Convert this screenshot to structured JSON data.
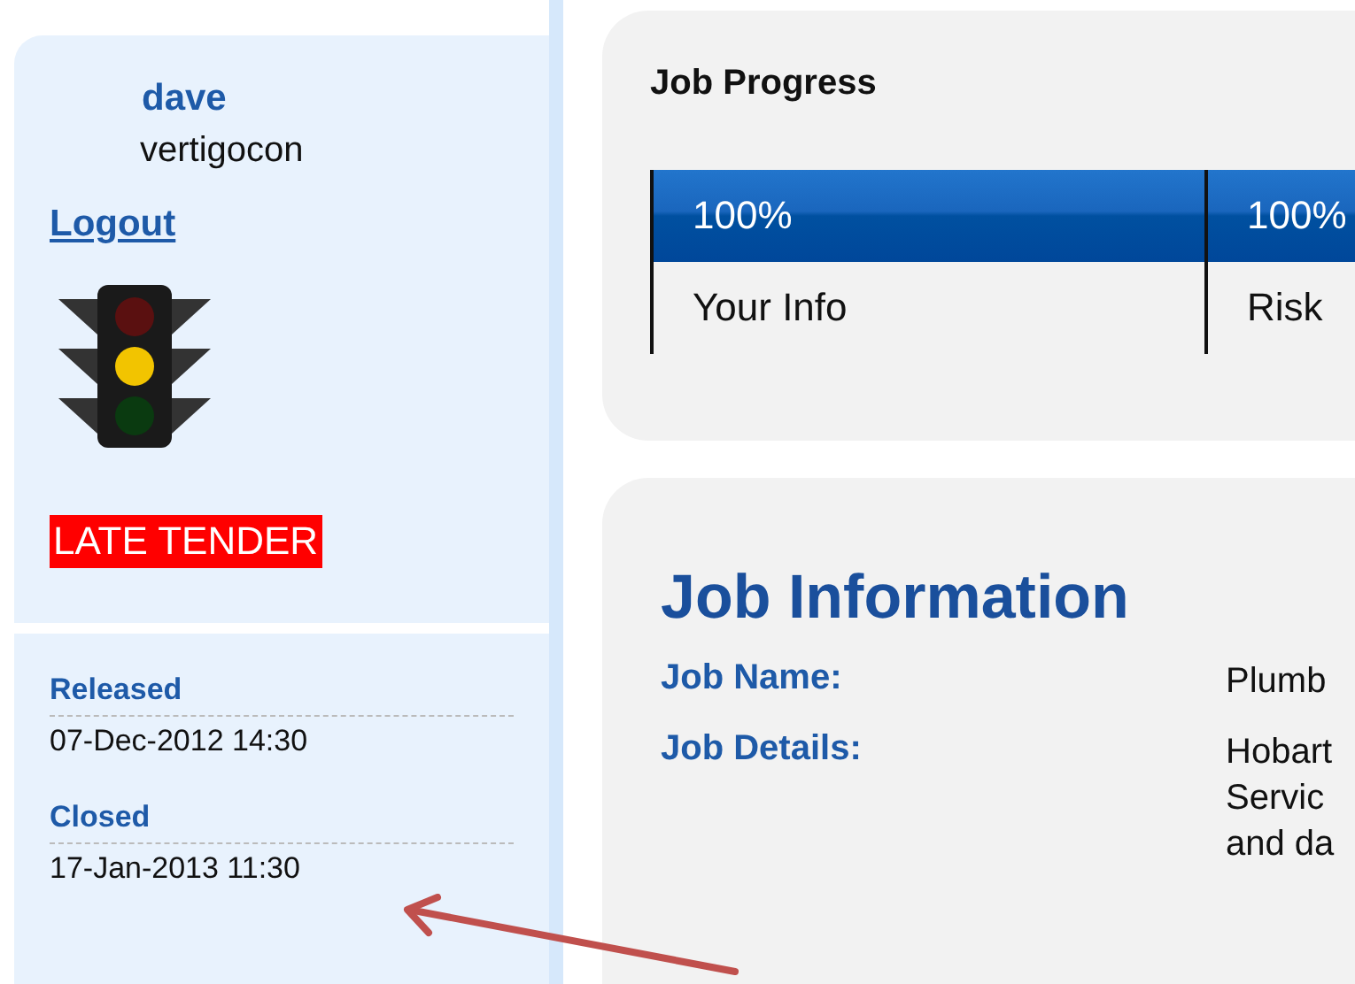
{
  "user": {
    "name": "dave",
    "company": "vertigocon",
    "logout": "Logout",
    "lamps": [
      {
        "on": false
      },
      {
        "on": true
      },
      {
        "on": false
      }
    ],
    "badge": "LATE TENDER"
  },
  "dates": [
    {
      "label": "Released",
      "value": "07-Dec-2012 14:30"
    },
    {
      "label": "Closed",
      "value": "17-Jan-2013 11:30"
    }
  ],
  "job_progress": {
    "title": "Job Progress",
    "columns": [
      {
        "percent": "100%",
        "label": "Your Info"
      },
      {
        "percent": "100%",
        "label": "Risk"
      }
    ]
  },
  "job_information": {
    "title": "Job Information",
    "fields": [
      {
        "label": "Job Name:",
        "value_lines": [
          "Plumb"
        ]
      },
      {
        "label": "Job Details:",
        "value_lines": [
          "Hobart",
          "Servic",
          "and da"
        ]
      }
    ]
  }
}
